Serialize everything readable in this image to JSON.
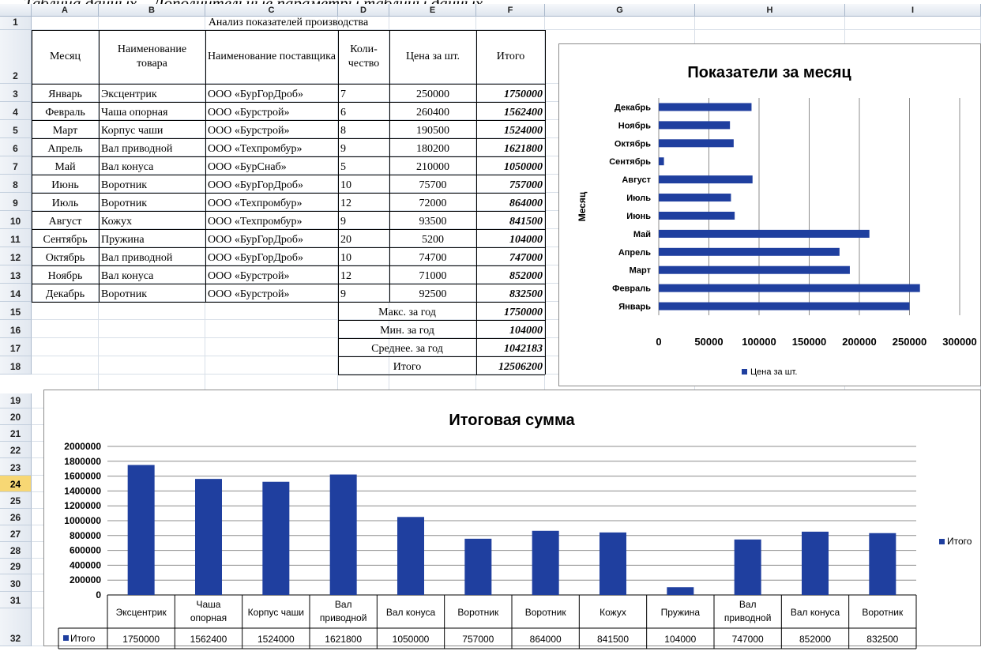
{
  "caption": "Таблица данных – Дополнительные параметры таблицы данных.",
  "columns": [
    "A",
    "B",
    "C",
    "D",
    "E",
    "F",
    "G",
    "H",
    "I"
  ],
  "rows": [
    "1",
    "2",
    "3",
    "4",
    "5",
    "6",
    "7",
    "8",
    "9",
    "10",
    "11",
    "12",
    "13",
    "14",
    "15",
    "16",
    "17",
    "18",
    "19",
    "20",
    "21",
    "22",
    "23",
    "24",
    "25",
    "26",
    "27",
    "28",
    "29",
    "30",
    "31",
    "32"
  ],
  "active_row": "24",
  "table": {
    "title": "Анализ показателей производства",
    "headers": {
      "month": "Месяц",
      "product": "Наименование товара",
      "supplier": "Наименование поставщика",
      "qty": "Коли-чество",
      "price": "Цена за шт.",
      "total": "Итого"
    },
    "rows": [
      [
        "Январь",
        "Эксцентрик",
        "ООО «БурГорДроб»",
        "7",
        "250000",
        "1750000"
      ],
      [
        "Февраль",
        "Чаша опорная",
        "ООО «Бурстрой»",
        "6",
        "260400",
        "1562400"
      ],
      [
        "Март",
        "Корпус чаши",
        "ООО «Бурстрой»",
        "8",
        "190500",
        "1524000"
      ],
      [
        "Апрель",
        "Вал приводной",
        "ООО «Техпромбур»",
        "9",
        "180200",
        "1621800"
      ],
      [
        "Май",
        "Вал конуса",
        "ООО «БурСнаб»",
        "5",
        "210000",
        "1050000"
      ],
      [
        "Июнь",
        "Воротник",
        "ООО «БурГорДроб»",
        "10",
        "75700",
        "757000"
      ],
      [
        "Июль",
        "Воротник",
        "ООО «Техпромбур»",
        "12",
        "72000",
        "864000"
      ],
      [
        "Август",
        "Кожух",
        "ООО «Техпромбур»",
        "9",
        "93500",
        "841500"
      ],
      [
        "Сентябрь",
        "Пружина",
        "ООО «БурГорДроб»",
        "20",
        "5200",
        "104000"
      ],
      [
        "Октябрь",
        "Вал приводной",
        "ООО «БурГорДроб»",
        "10",
        "74700",
        "747000"
      ],
      [
        "Ноябрь",
        "Вал конуса",
        "ООО «Бурстрой»",
        "12",
        "71000",
        "852000"
      ],
      [
        "Декабрь",
        "Воротник",
        "ООО «Бурстрой»",
        "9",
        "92500",
        "832500"
      ]
    ],
    "summary": [
      {
        "label": "Макс. за год",
        "value": "1750000"
      },
      {
        "label": "Мин. за год",
        "value": "104000"
      },
      {
        "label": "Среднее. за год",
        "value": "1042183"
      },
      {
        "label": "Итого",
        "value": "12506200"
      }
    ]
  },
  "colors": {
    "series": "#1f3f9f",
    "grid": "#8c8c8c",
    "active_row": "#f7d774"
  },
  "chart_data": [
    {
      "type": "bar",
      "orientation": "horizontal",
      "title": "Показатели за месяц",
      "ylabel": "Месяц",
      "xlabel": "",
      "categories": [
        "Январь",
        "Февраль",
        "Март",
        "Апрель",
        "Май",
        "Июнь",
        "Июль",
        "Август",
        "Сентябрь",
        "Октябрь",
        "Ноябрь",
        "Декабрь"
      ],
      "series": [
        {
          "name": "Цена за шт.",
          "values": [
            250000,
            260400,
            190500,
            180200,
            210000,
            75700,
            72000,
            93500,
            5200,
            74700,
            71000,
            92500
          ]
        }
      ],
      "xlim": [
        0,
        300000
      ],
      "ticks": [
        "0",
        "50000",
        "100000",
        "150000",
        "200000",
        "250000",
        "300000"
      ],
      "legend": "bottom",
      "grid": true
    },
    {
      "type": "bar",
      "orientation": "vertical",
      "title": "Итоговая сумма",
      "xlabel": "",
      "ylabel": "",
      "categories": [
        "Эксцентрик",
        "Чаша опорная",
        "Корпус чаши",
        "Вал приводной",
        "Вал конуса",
        "Воротник",
        "Воротник",
        "Кожух",
        "Пружина",
        "Вал приводной",
        "Вал конуса",
        "Воротник"
      ],
      "series": [
        {
          "name": "Итого",
          "values": [
            1750000,
            1562400,
            1524000,
            1621800,
            1050000,
            757000,
            864000,
            841500,
            104000,
            747000,
            852000,
            832500
          ]
        }
      ],
      "ylim": [
        0,
        2000000
      ],
      "ticks": [
        "0",
        "200000",
        "400000",
        "600000",
        "800000",
        "1000000",
        "1200000",
        "1400000",
        "1600000",
        "1800000",
        "2000000"
      ],
      "legend": "right",
      "data_table": true,
      "grid": true
    }
  ]
}
